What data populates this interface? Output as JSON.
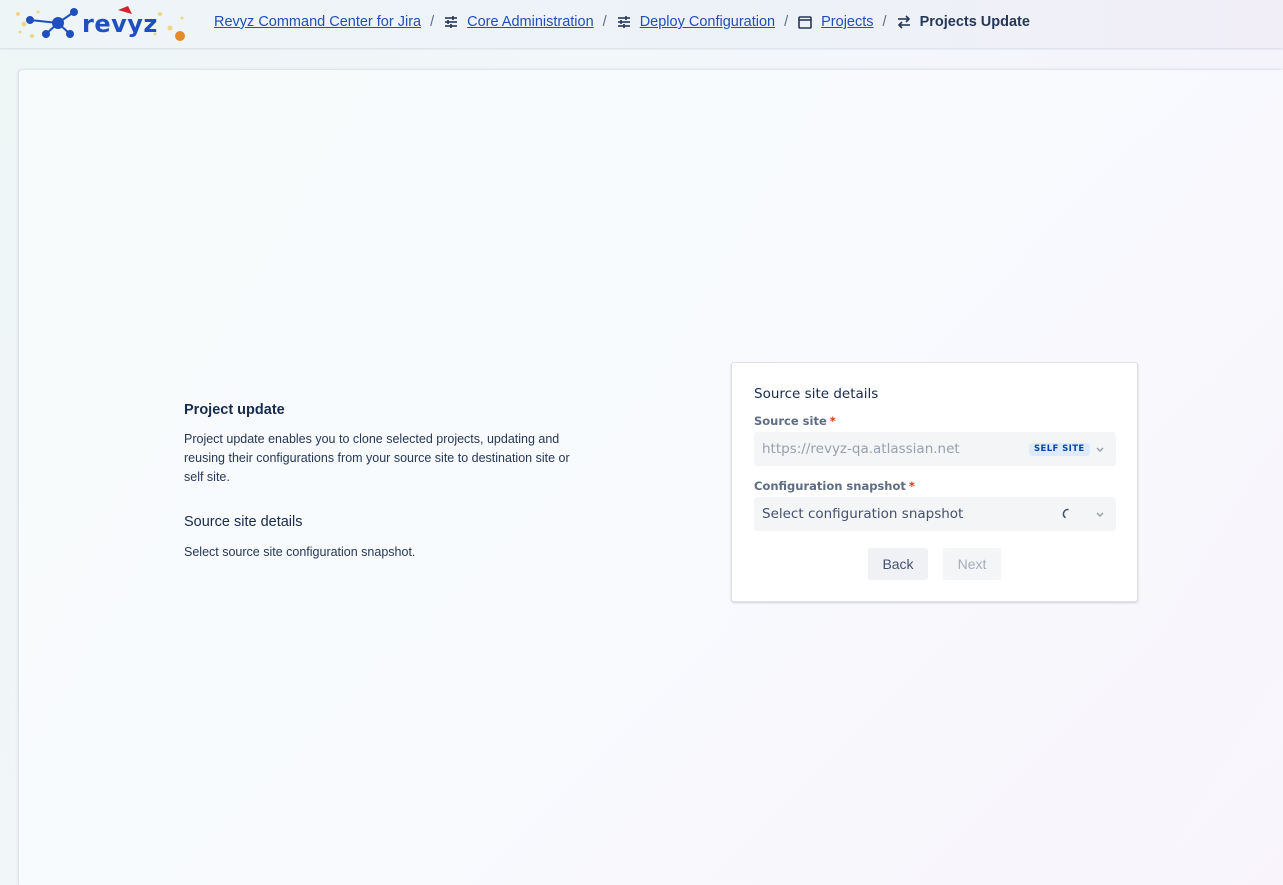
{
  "header": {
    "logo_text": "revyz",
    "breadcrumbs": [
      {
        "label": "Revyz Command Center for Jira",
        "icon": "none"
      },
      {
        "label": "Core Administration",
        "icon": "sliders-icon"
      },
      {
        "label": "Deploy Configuration",
        "icon": "sliders-icon"
      },
      {
        "label": "Projects",
        "icon": "window-icon"
      },
      {
        "label": "Projects Update",
        "icon": "swap-arrows-icon"
      }
    ],
    "separator": "/"
  },
  "info": {
    "title": "Project update",
    "description": "Project update enables you to clone selected projects, updating and reusing their configurations from your source site to destination site or self site.",
    "section_title": "Source site details",
    "section_description": "Select source site configuration snapshot."
  },
  "card": {
    "title": "Source site details",
    "source_site": {
      "label": "Source site",
      "required_mark": "*",
      "value": "https://revyz-qa.atlassian.net",
      "badge": "SELF SITE"
    },
    "snapshot": {
      "label": "Configuration snapshot",
      "required_mark": "*",
      "placeholder": "Select configuration snapshot"
    },
    "back_label": "Back",
    "next_label": "Next"
  },
  "colors": {
    "link": "#1f4fbf",
    "required": "#de350b",
    "badge_bg": "#deebff",
    "badge_text": "#0747a6"
  }
}
